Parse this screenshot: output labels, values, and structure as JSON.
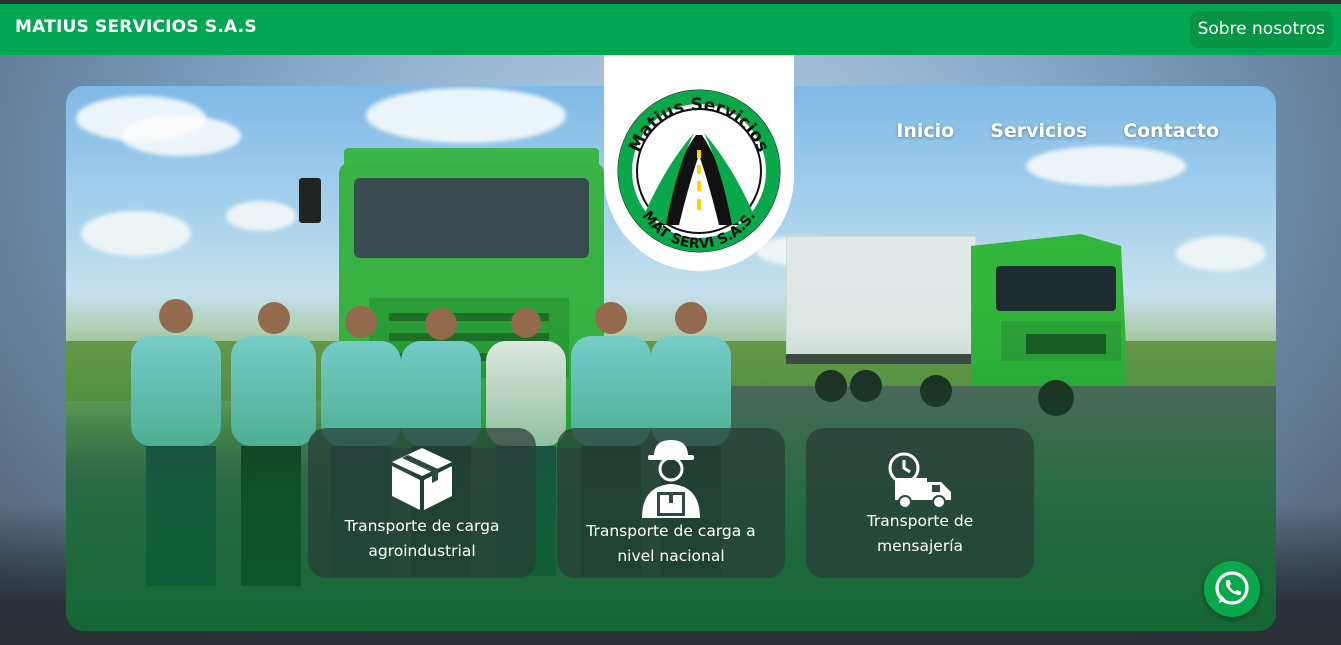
{
  "header": {
    "brand": "MATIUS SERVICIOS S.A.S",
    "about_label": "Sobre nosotros"
  },
  "nav": {
    "items": [
      "Inicio",
      "Servicios",
      "Contacto"
    ]
  },
  "logo": {
    "top_text": "Matius Servicios",
    "bottom_text": "MAT SERVI S.A.S."
  },
  "services": [
    {
      "line1": "Transporte de carga",
      "line2": "agroindustrial",
      "icon": "box-icon"
    },
    {
      "line1": "Transporte de carga a",
      "line2": "nivel nacional",
      "icon": "delivery-person-icon"
    },
    {
      "line1": "Transporte de",
      "line2": "mensajería",
      "icon": "fast-delivery-truck-icon"
    }
  ],
  "colors": {
    "brand_green": "#00a651",
    "button_green": "#079444",
    "whatsapp_green": "#0aa84a"
  }
}
